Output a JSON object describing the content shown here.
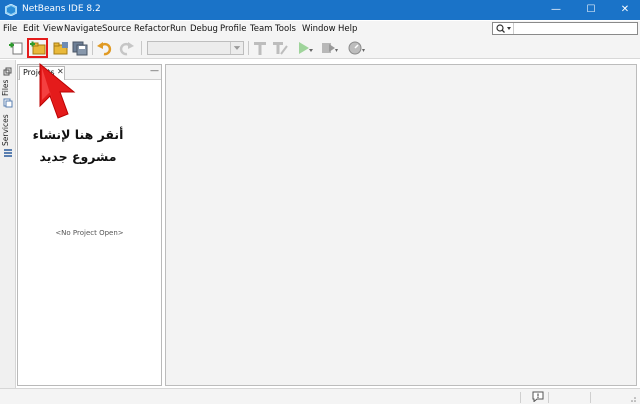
{
  "window": {
    "title": "NetBeans IDE 8.2",
    "controls": {
      "minimize": "—",
      "maximize": "☐",
      "close": "✕"
    }
  },
  "menu": {
    "items": [
      "File",
      "Edit",
      "View",
      "Navigate",
      "Source",
      "Refactor",
      "Run",
      "Debug",
      "Profile",
      "Team",
      "Tools",
      "Window",
      "Help"
    ]
  },
  "search": {
    "icon": "search-icon",
    "value": ""
  },
  "toolbar": {
    "buttons": [
      "new-file-icon",
      "new-project-icon",
      "open-project-icon",
      "save-all-icon",
      "undo-icon",
      "redo-icon",
      "build-icon",
      "clean-build-icon",
      "run-icon",
      "debug-icon",
      "profile-icon"
    ],
    "config_value": ""
  },
  "side_tabs": {
    "files": "Files",
    "services": "Services"
  },
  "projects_panel": {
    "tab_label": "Projects",
    "close": "✕",
    "minimize": "—",
    "empty_text": "<No Project Open>"
  },
  "annotation": {
    "line1": "أنقر هنا لإنشاء",
    "line2": "مشروع جديد",
    "color": "#e41b1b"
  },
  "colors": {
    "titlebar": "#1a73c8",
    "highlight": "#e41b1b",
    "run_green": "#3fae3a"
  }
}
